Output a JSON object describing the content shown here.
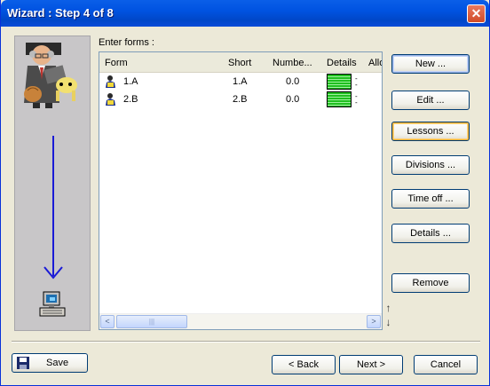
{
  "window": {
    "title": "Wizard : Step 4 of 8",
    "close_glyph": "✕"
  },
  "forms_label": "Enter forms :",
  "table": {
    "columns": [
      "Form",
      "Short",
      "Numbe...",
      "Details",
      "Allo"
    ],
    "rows": [
      {
        "form": "1.A",
        "short": "1.A",
        "number": "0.0",
        "details_dashes": [
          "-",
          "-"
        ]
      },
      {
        "form": "2.B",
        "short": "2.B",
        "number": "0.0",
        "details_dashes": [
          "-",
          "-"
        ]
      }
    ],
    "scroll_left": "<",
    "scroll_right": ">",
    "thumb_grip": "|||"
  },
  "reorder": {
    "up": "↑",
    "down": "↓"
  },
  "buttons": {
    "new": "New ...",
    "edit": "Edit ...",
    "lessons": "Lessons ...",
    "divisions": "Divisions ...",
    "time_off": "Time off ...",
    "details": "Details ...",
    "remove": "Remove"
  },
  "footer": {
    "save": "Save",
    "back": "< Back",
    "next": "Next >",
    "cancel": "Cancel"
  },
  "colors": {
    "title_blue": "#0053e1",
    "arrow_blue": "#1a1ad6",
    "details_green": "#1fbf1f"
  },
  "icons": [
    "teacher-illustration",
    "down-arrow-icon",
    "computer-icon",
    "form-person-icon",
    "floppy-save-icon"
  ]
}
